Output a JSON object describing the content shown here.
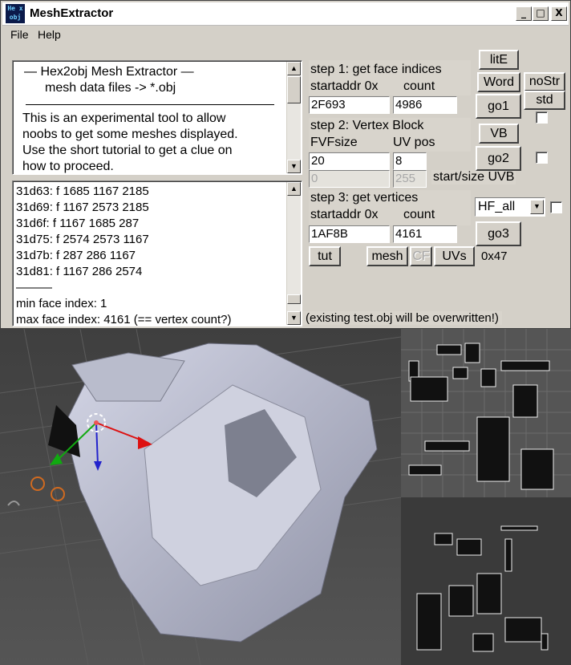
{
  "window": {
    "title": "MeshExtractor",
    "icon_text_top": "He x",
    "icon_text_bottom": "obj",
    "controls": {
      "minimize": "_",
      "maximize": "□",
      "close": "X"
    }
  },
  "menu": {
    "file": "File",
    "help": "Help"
  },
  "info_box": {
    "line1": "—   Hex2obj Mesh Extractor   —",
    "line2": "mesh data files -> *.obj",
    "para": [
      "This is an experimental tool to allow",
      "noobs to get some meshes displayed.",
      "Use the short tutorial to get a clue on",
      "how to proceed."
    ]
  },
  "output_box": {
    "rows": [
      "31d63: f  1685 1167 2185",
      "31d69: f  1167 2573 2185",
      "31d6f: f  1167 1685 287",
      "31d75: f  2574 2573 1167",
      "31d7b: f  287 286 1167",
      "31d81: f  1167 286 2574"
    ],
    "separator": "———",
    "min_line": "min face index: 1",
    "max_line": "max face index: 4161 (== vertex count?)"
  },
  "step1": {
    "title": "step 1: get face indices",
    "addr_label": "startaddr 0x",
    "count_label": "count",
    "addr": "2F693",
    "count": "4986"
  },
  "step2": {
    "title": "step 2: Vertex Block",
    "fvf_label": "FVFsize",
    "uvpos_label": "UV pos",
    "fvf": "20",
    "uvpos": "8",
    "uvb_start": "0",
    "uvb_size": "255",
    "uvb_label": "start/size UVB"
  },
  "step3": {
    "title": "step 3: get vertices",
    "addr_label": "startaddr 0x",
    "count_label": "count",
    "addr": "1AF8B",
    "count": "4161"
  },
  "buttons": {
    "lite": "litE",
    "word": "Word",
    "nostr": "noStr",
    "std": "std",
    "go1": "go1",
    "vb": "VB",
    "go2": "go2",
    "go3": "go3",
    "tut": "tut",
    "mesh": "mesh",
    "cf": "CF",
    "uvs": "UVs"
  },
  "dropdown": {
    "value": "HF_all",
    "arrow": "▼"
  },
  "hex_label": "0x47",
  "warning": "(existing test.obj will be overwritten!)"
}
